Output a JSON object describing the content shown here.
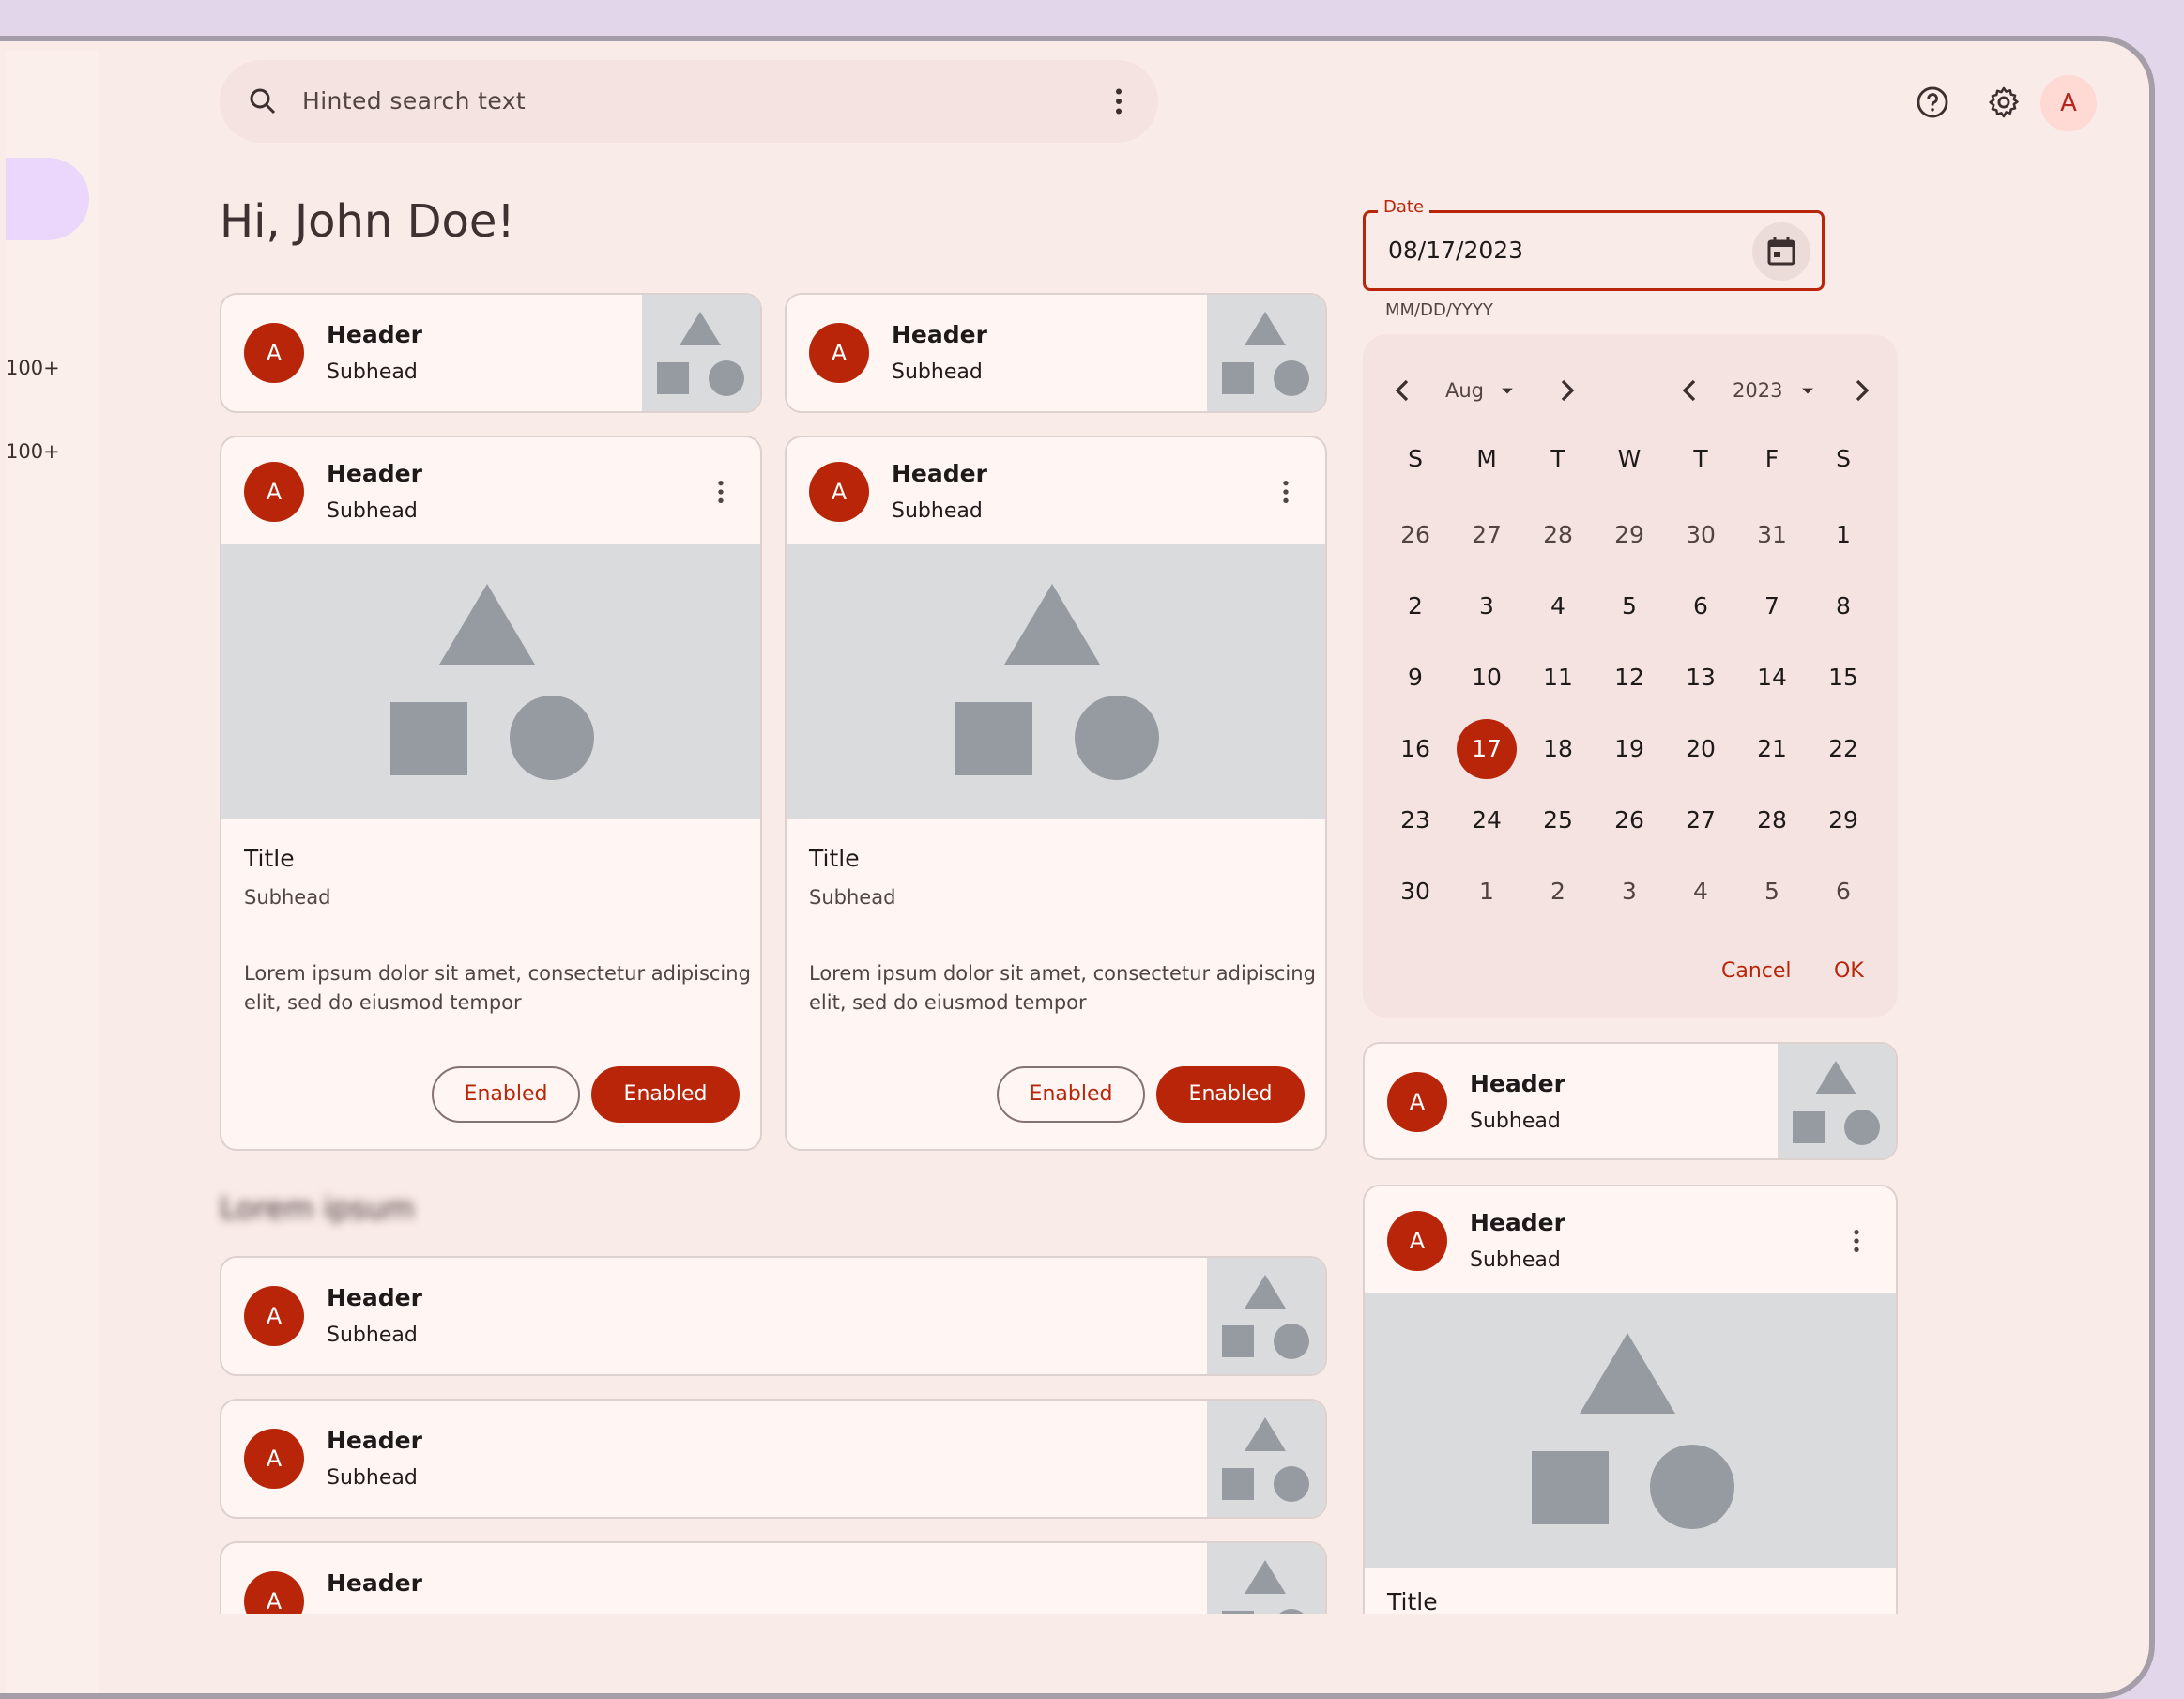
{
  "colors": {
    "primary": "#b82508",
    "surface": "#f9ebe8",
    "card": "#fff6f4",
    "media": "#dadbdd",
    "shape": "#969ba1",
    "rail_active": "#ead7fb",
    "frame": "#e2d6eb"
  },
  "rail": {
    "badges": [
      "100+",
      "100+"
    ]
  },
  "search": {
    "placeholder": "Hinted search text",
    "leading_icon": "search-icon",
    "trailing_icon": "more-vert-icon"
  },
  "top_actions": {
    "help_icon": "help-icon",
    "settings_icon": "gear-icon",
    "avatar_initial": "A"
  },
  "greeting": "Hi, John Doe!",
  "compact_cards": [
    {
      "avatar": "A",
      "header": "Header",
      "subhead": "Subhead"
    },
    {
      "avatar": "A",
      "header": "Header",
      "subhead": "Subhead"
    }
  ],
  "media_cards": [
    {
      "avatar": "A",
      "header": "Header",
      "subhead": "Subhead",
      "title": "Title",
      "title_subhead": "Subhead",
      "body": "Lorem ipsum dolor sit amet, consectetur adipiscing elit, sed do eiusmod tempor",
      "outlined_button": "Enabled",
      "filled_button": "Enabled"
    },
    {
      "avatar": "A",
      "header": "Header",
      "subhead": "Subhead",
      "title": "Title",
      "title_subhead": "Subhead",
      "body": "Lorem ipsum dolor sit amet, consectetur adipiscing elit, sed do eiusmod tempor",
      "outlined_button": "Enabled",
      "filled_button": "Enabled"
    }
  ],
  "section_title": "Lorem ipsum",
  "list_cards": [
    {
      "avatar": "A",
      "header": "Header",
      "subhead": "Subhead"
    },
    {
      "avatar": "A",
      "header": "Header",
      "subhead": "Subhead"
    },
    {
      "avatar": "A",
      "header": "Header",
      "subhead": ""
    }
  ],
  "date_input": {
    "label": "Date",
    "value": "08/17/2023",
    "supporting": "MM/DD/YYYY",
    "icon": "calendar-icon"
  },
  "date_picker": {
    "month": "Aug",
    "year": "2023",
    "weekdays": [
      "S",
      "M",
      "T",
      "W",
      "T",
      "F",
      "S"
    ],
    "weeks": [
      [
        "26",
        "27",
        "28",
        "29",
        "30",
        "31",
        "1"
      ],
      [
        "2",
        "3",
        "4",
        "5",
        "6",
        "7",
        "8"
      ],
      [
        "9",
        "10",
        "11",
        "12",
        "13",
        "14",
        "15"
      ],
      [
        "16",
        "17",
        "18",
        "19",
        "20",
        "21",
        "22"
      ],
      [
        "23",
        "24",
        "25",
        "26",
        "27",
        "28",
        "29"
      ],
      [
        "30",
        "1",
        "2",
        "3",
        "4",
        "5",
        "6"
      ]
    ],
    "selected_day": "17",
    "cancel": "Cancel",
    "ok": "OK"
  },
  "right_compact_card": {
    "avatar": "A",
    "header": "Header",
    "subhead": "Subhead"
  },
  "right_media_card": {
    "avatar": "A",
    "header": "Header",
    "subhead": "Subhead",
    "title": "Title"
  }
}
